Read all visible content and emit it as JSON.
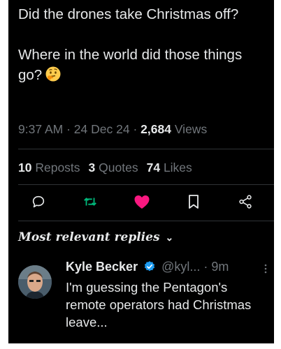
{
  "tweet": {
    "line1": "Did the drones take Christmas off?",
    "line2": "Where in the world did those things go?",
    "emoji": "thinking-face-emoji",
    "time": "9:37 AM",
    "date": "24 Dec 24",
    "views_count": "2,684",
    "views_label": "Views",
    "dot": "·"
  },
  "stats": {
    "reposts_count": "10",
    "reposts_label": "Reposts",
    "quotes_count": "3",
    "quotes_label": "Quotes",
    "likes_count": "74",
    "likes_label": "Likes"
  },
  "actions": {
    "reply_icon": "reply-icon",
    "repost_icon": "repost-icon",
    "like_icon": "heart-icon",
    "bookmark_icon": "bookmark-icon",
    "share_icon": "share-icon"
  },
  "replies": {
    "header": "Most relevant replies",
    "chevron": "⌄"
  },
  "reply": {
    "name": "Kyle Becker",
    "handle": "@kyl...",
    "time": "9m",
    "dot": "·",
    "text": "I'm guessing the Pentagon's remote operators had Christmas leave..."
  },
  "colors": {
    "background": "#000000",
    "text": "#e7e9ea",
    "secondary": "#71767b",
    "repost_green": "#00ba7c",
    "like_pink": "#f91880",
    "verified_blue": "#1d9bf0"
  }
}
